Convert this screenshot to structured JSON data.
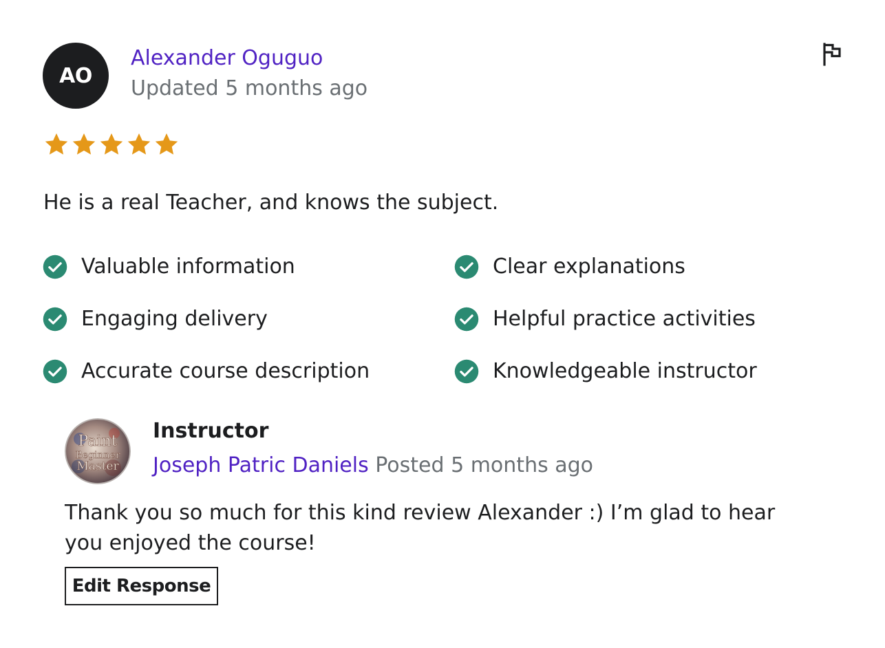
{
  "review": {
    "avatar_initials": "AO",
    "reviewer_name": "Alexander Oguguo",
    "updated_text": "Updated 5 months ago",
    "rating": 5,
    "rating_max": 5,
    "star_color": "#e59819",
    "comment": "He is a real Teacher, and knows the subject.",
    "tags": [
      "Valuable information",
      "Clear explanations",
      "Engaging delivery",
      "Helpful practice activities",
      "Accurate course description",
      "Knowledgeable instructor"
    ],
    "check_color": "#2b8a72",
    "flag_icon": "flag-icon"
  },
  "response": {
    "role": "Instructor",
    "avatar_text": [
      "Paint",
      "Beginner",
      "Master"
    ],
    "instructor_name": "Joseph Patric Daniels",
    "posted_text": "Posted 5 months ago",
    "text": "Thank you so much for this kind review Alexander :) I’m glad to hear you enjoyed the course!",
    "edit_button_label": "Edit Response"
  },
  "colors": {
    "link": "#5022c3",
    "muted": "#6a6f73",
    "text": "#1c1d1f"
  }
}
